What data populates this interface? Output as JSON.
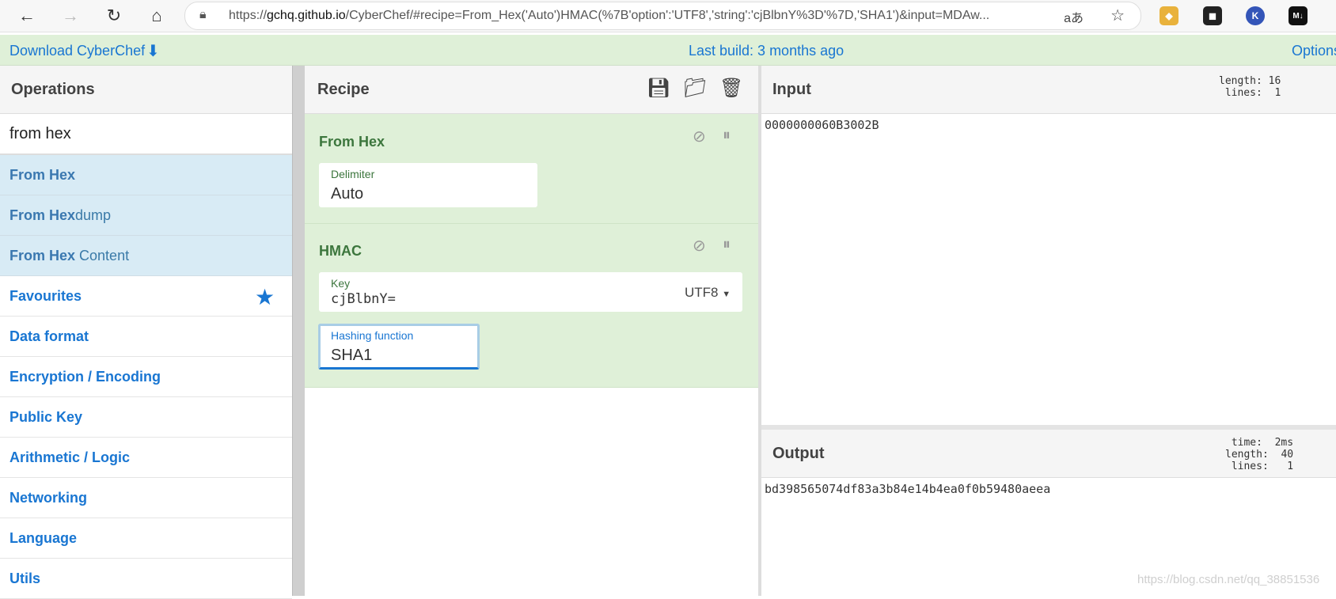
{
  "browser": {
    "url_prefix": "https://",
    "url_host": "gchq.github.io",
    "url_rest": "/CyberChef/#recipe=From_Hex('Auto')HMAC(%7B'option':'UTF8','string':'cjBlbnY%3D'%7D,'SHA1')&input=MDAw...",
    "read_aloud": "aあ",
    "extensions": [
      {
        "name": "shield",
        "color": "#e9b23c",
        "glyph": "◆"
      },
      {
        "name": "game",
        "color": "#222222",
        "glyph": "◼"
      },
      {
        "name": "k",
        "color": "#3455b8",
        "glyph": "K"
      },
      {
        "name": "markdown",
        "color": "#111111",
        "glyph": "M↓"
      }
    ]
  },
  "banner": {
    "download": "Download CyberChef",
    "build": "Last build: 3 months ago",
    "options": "Options"
  },
  "operations": {
    "title": "Operations",
    "search": "from hex",
    "results": [
      {
        "bold": "From Hex",
        "rest": ""
      },
      {
        "bold": "From Hex",
        "rest": "dump"
      },
      {
        "bold": "From Hex",
        "rest": " Content"
      }
    ],
    "categories": [
      "Favourites",
      "Data format",
      "Encryption / Encoding",
      "Public Key",
      "Arithmetic / Logic",
      "Networking",
      "Language",
      "Utils"
    ]
  },
  "recipe": {
    "title": "Recipe",
    "ops": [
      {
        "name": "From Hex",
        "fields": [
          {
            "label": "Delimiter",
            "value": "Auto"
          }
        ]
      },
      {
        "name": "HMAC",
        "key_label": "Key",
        "key_value": "cjBlbnY=",
        "key_encoding": "UTF8",
        "hash_label": "Hashing function",
        "hash_value": "SHA1"
      }
    ]
  },
  "input": {
    "title": "Input",
    "stats": "length: 16\n lines:  1",
    "text": "0000000060B3002B"
  },
  "output": {
    "title": "Output",
    "stats": "time:  2ms\nlength:  40\n lines:   1",
    "text": "bd398565074df83a3b84e14b4ea0f0b59480aeea"
  },
  "watermark": "https://blog.csdn.net/qq_38851536"
}
